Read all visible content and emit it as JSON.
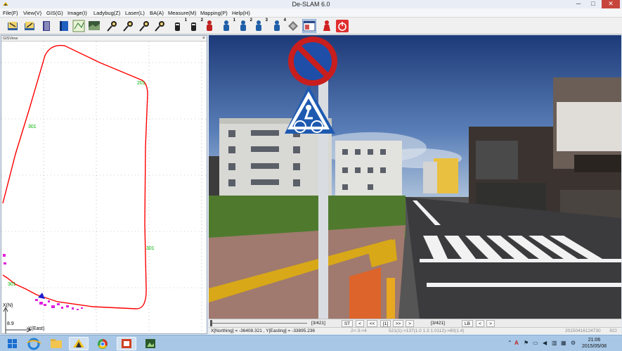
{
  "window": {
    "title": "De-SLAM 6.0",
    "min": "─",
    "max": "□",
    "close": "✕"
  },
  "menu": [
    {
      "label": "File(F)"
    },
    {
      "label": "View(V)"
    },
    {
      "label": "GIS(G)"
    },
    {
      "label": "Image(I)"
    },
    {
      "label": "Ladybug(Z)"
    },
    {
      "label": "Laser(L)"
    },
    {
      "label": "BA(A)"
    },
    {
      "label": "Measure(M)"
    },
    {
      "label": "Mapping(P)"
    },
    {
      "label": "Help(H)"
    }
  ],
  "toolbar": {
    "icons": [
      "open-project-icon",
      "open-folder-icon",
      "book-icon",
      "book-blue-icon",
      "map-grid-icon",
      "image-view-icon",
      "probe-icon",
      "probe-2-icon",
      "probe-3-icon",
      "probe-4-icon",
      "camera-1-icon",
      "camera-2-icon",
      "red-figure-icon",
      "blue-figure-1-icon",
      "blue-figure-2-icon",
      "blue-figure-3-icon",
      "blue-figure-4-icon",
      "diamond-icon",
      "window-view-icon",
      "red-person-icon",
      "power-icon"
    ],
    "superscripts": {
      "camera_1": "1",
      "camera_2": "2",
      "fig_1": "1",
      "fig_2": "2",
      "fig_3": "3",
      "fig_4": "4"
    }
  },
  "gis": {
    "header": "GISView",
    "close": "×",
    "labels": {
      "a": "301",
      "b": "201",
      "c": "301",
      "d": "301"
    },
    "axis": {
      "n": "X(N)",
      "e": "Y(East)",
      "scale": "8.9"
    },
    "colors": {
      "track": "#ff0000",
      "points": "#e020e0",
      "grid": "#9a9a9a",
      "label": "#00b000"
    }
  },
  "viewer": {
    "left_frame": "[3/421]",
    "right_frame": "[3/421]",
    "st": "ST",
    "lb": "LB",
    "prev": "<",
    "prev_fast": "<<",
    "frame_num": "[1]",
    "next_fast": ">>",
    "next": ">",
    "prev2": "<",
    "next2": ">"
  },
  "status": {
    "coords": "X[Northing] = -36408.321 , Y[Easting] = -33895.236",
    "info1": "2<-3->4",
    "info2": "521(1)->137(1.0 1.3 1.0112)->80(1.4)",
    "date": "20150416124730",
    "tag": "SCI"
  },
  "taskbar": {
    "apps": [
      "start-icon",
      "ie-icon",
      "explorer-icon",
      "deslam-icon",
      "chrome-icon",
      "office-icon",
      "media-icon"
    ],
    "time": "21:06",
    "date": "2015/05/08",
    "lang": "A"
  }
}
